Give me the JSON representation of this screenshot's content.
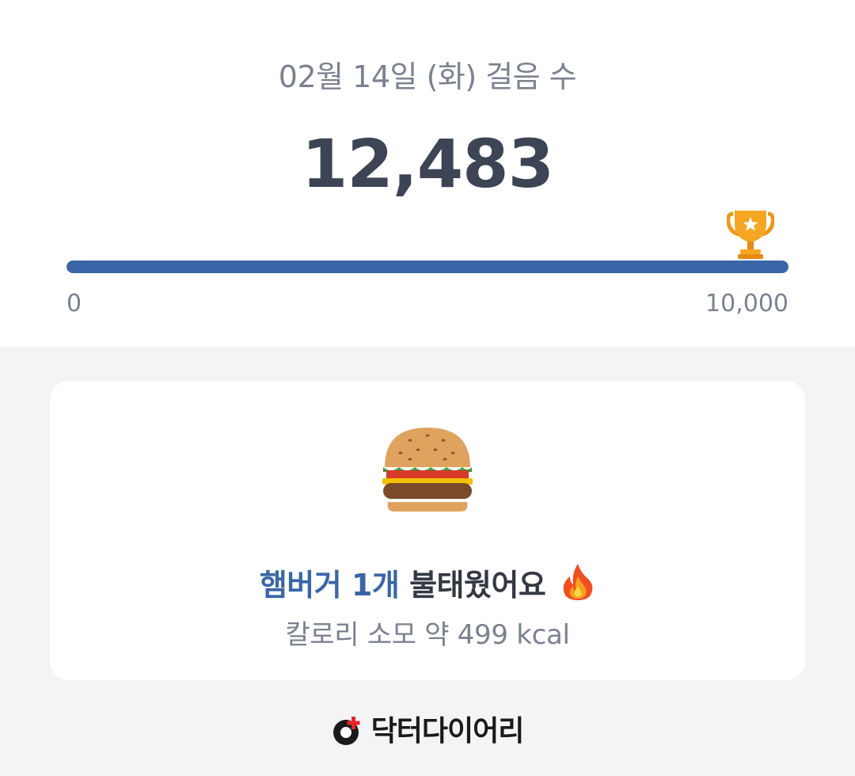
{
  "steps": {
    "date_title": "02월 14일 (화) 걸음 수",
    "count": "12,483",
    "goal_progress": 1.0,
    "scale_min": "0",
    "scale_max": "10,000",
    "goal_icon": "trophy-icon"
  },
  "card": {
    "food_icon": "hamburger-icon",
    "headline_highlight": "햄버거 1개",
    "headline_rest": "불태웠어요",
    "headline_icon": "fire-icon",
    "calorie_text": "칼로리 소모 약 499 kcal"
  },
  "brand": {
    "logo_icon": "doctor-diary-logo-icon",
    "name": "닥터다이어리"
  },
  "colors": {
    "accent": "#3a66a7",
    "text_dark": "#3d4455",
    "text_muted": "#7a8190",
    "background": "#f4f4f4",
    "trophy": "#f5a623"
  }
}
